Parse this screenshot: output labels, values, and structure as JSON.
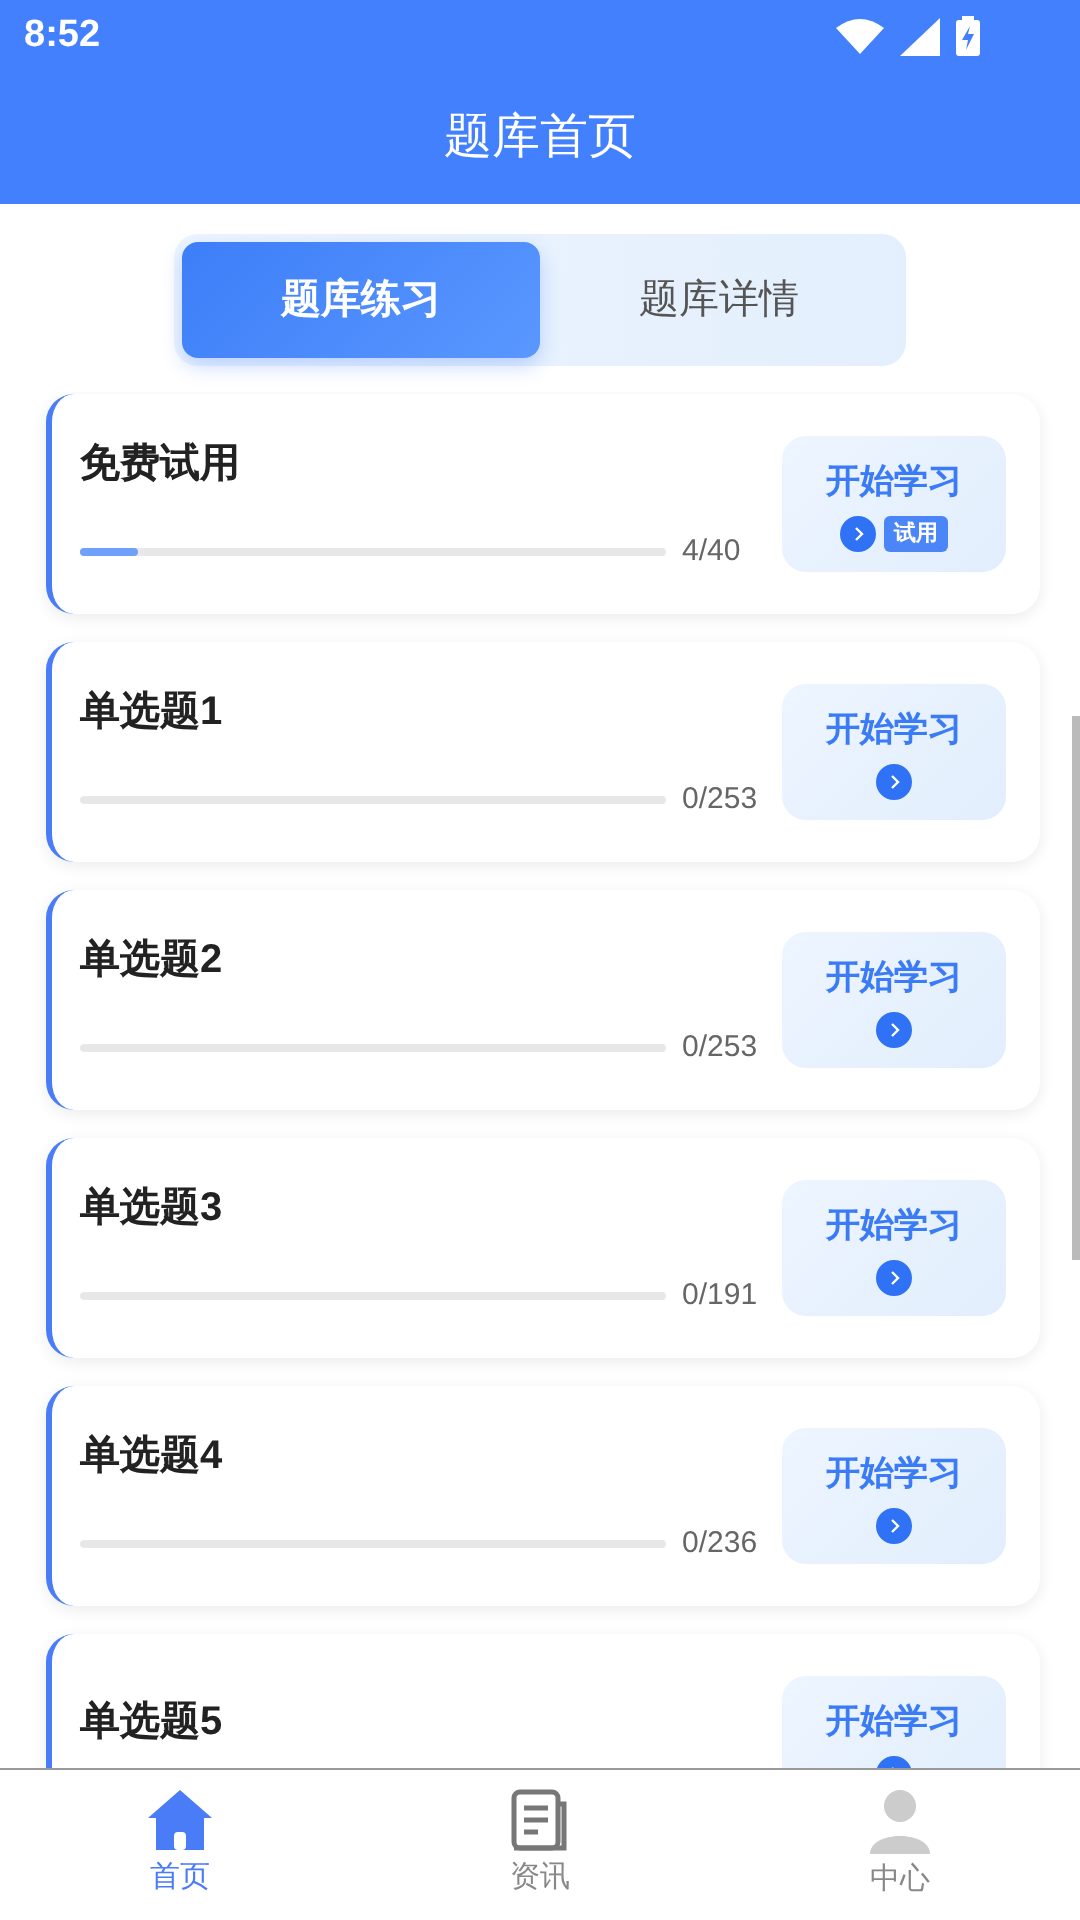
{
  "status_bar": {
    "time": "8:52"
  },
  "header": {
    "title": "题库首页"
  },
  "tabs": [
    {
      "label": "题库练习",
      "selected": true
    },
    {
      "label": "题库详情",
      "selected": false
    }
  ],
  "banks": [
    {
      "title": "免费试用",
      "level": 0.1,
      "count": "4/40",
      "button": "开始学习",
      "badge": "试用"
    },
    {
      "title": "单选题1",
      "count": "0/253",
      "button": "开始学习"
    },
    {
      "title": "单选题2",
      "count": "0/253",
      "button": "开始学习"
    },
    {
      "title": "单选题3",
      "count": "0/191",
      "button": "开始学习"
    },
    {
      "title": "单选题4",
      "count": "0/236",
      "button": "开始学习"
    },
    {
      "title": "单选题5",
      "button": "开始学习"
    }
  ],
  "bottom_nav": [
    {
      "label": "首页",
      "selected": true,
      "kind": "home"
    },
    {
      "label": "资讯",
      "selected": false,
      "kind": "news"
    },
    {
      "label": "中心",
      "selected": false,
      "kind": "person"
    }
  ]
}
